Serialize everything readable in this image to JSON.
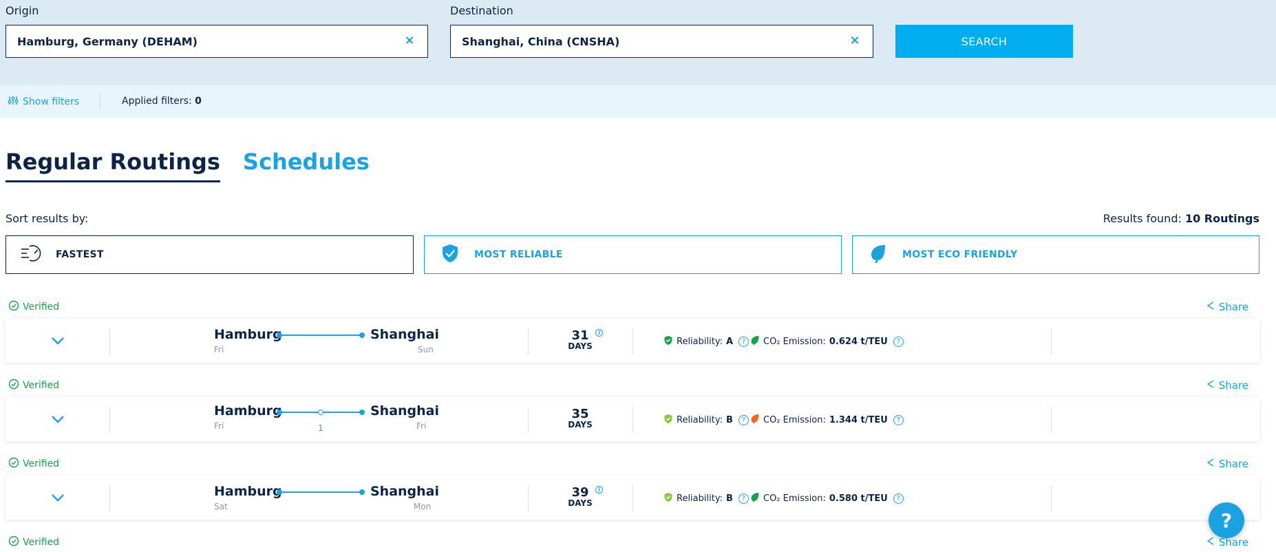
{
  "search": {
    "origin_label": "Origin",
    "origin_value": "Hamburg, Germany (DEHAM)",
    "destination_label": "Destination",
    "destination_value": "Shanghai, China (CNSHA)",
    "clear_glyph": "×",
    "search_button": "SEARCH"
  },
  "filters": {
    "show_filters": "Show filters",
    "applied_label": "Applied filters:",
    "applied_count": "0"
  },
  "tabs": [
    {
      "label": "Regular Routings",
      "active": true
    },
    {
      "label": "Schedules",
      "active": false
    }
  ],
  "sort": {
    "label": "Sort results by:",
    "options": [
      {
        "label": "FASTEST",
        "icon": "speed-icon",
        "selected": true
      },
      {
        "label": "MOST RELIABLE",
        "icon": "shield-check-icon",
        "selected": false
      },
      {
        "label": "MOST ECO FRIENDLY",
        "icon": "leaf-icon",
        "selected": false
      }
    ]
  },
  "results": {
    "label": "Results found:",
    "value": "10 Routings"
  },
  "routings": [
    {
      "verified": "Verified",
      "share": "Share",
      "origin": "Hamburg",
      "origin_day": "Fri",
      "destination": "Shanghai",
      "destination_day": "Sun",
      "transshipments": "",
      "days": "31",
      "days_label": "DAYS",
      "has_info": true,
      "reliability_label": "Reliability:",
      "reliability": "A",
      "reliability_color": "#17a34a",
      "co2_label": "CO₂ Emission:",
      "co2": "0.624 t/TEU",
      "co2_color": "#17a34a"
    },
    {
      "verified": "Verified",
      "share": "Share",
      "origin": "Hamburg",
      "origin_day": "Fri",
      "destination": "Shanghai",
      "destination_day": "Fri",
      "transshipments": "1",
      "days": "35",
      "days_label": "DAYS",
      "has_info": false,
      "reliability_label": "Reliability:",
      "reliability": "B",
      "reliability_color": "#8cc63f",
      "co2_label": "CO₂ Emission:",
      "co2": "1.344 t/TEU",
      "co2_color": "#f26b1d"
    },
    {
      "verified": "Verified",
      "share": "Share",
      "origin": "Hamburg",
      "origin_day": "Sat",
      "destination": "Shanghai",
      "destination_day": "Mon",
      "transshipments": "",
      "days": "39",
      "days_label": "DAYS",
      "has_info": true,
      "reliability_label": "Reliability:",
      "reliability": "B",
      "reliability_color": "#8cc63f",
      "co2_label": "CO₂ Emission:",
      "co2": "0.580 t/TEU",
      "co2_color": "#17a34a"
    },
    {
      "verified": "Verified",
      "share": "Share"
    }
  ],
  "help": "?",
  "colors": {
    "brand_dark": "#0b2447",
    "accent": "#1aa3e0",
    "search_button": "#00adef",
    "verified": "#17a34a"
  }
}
